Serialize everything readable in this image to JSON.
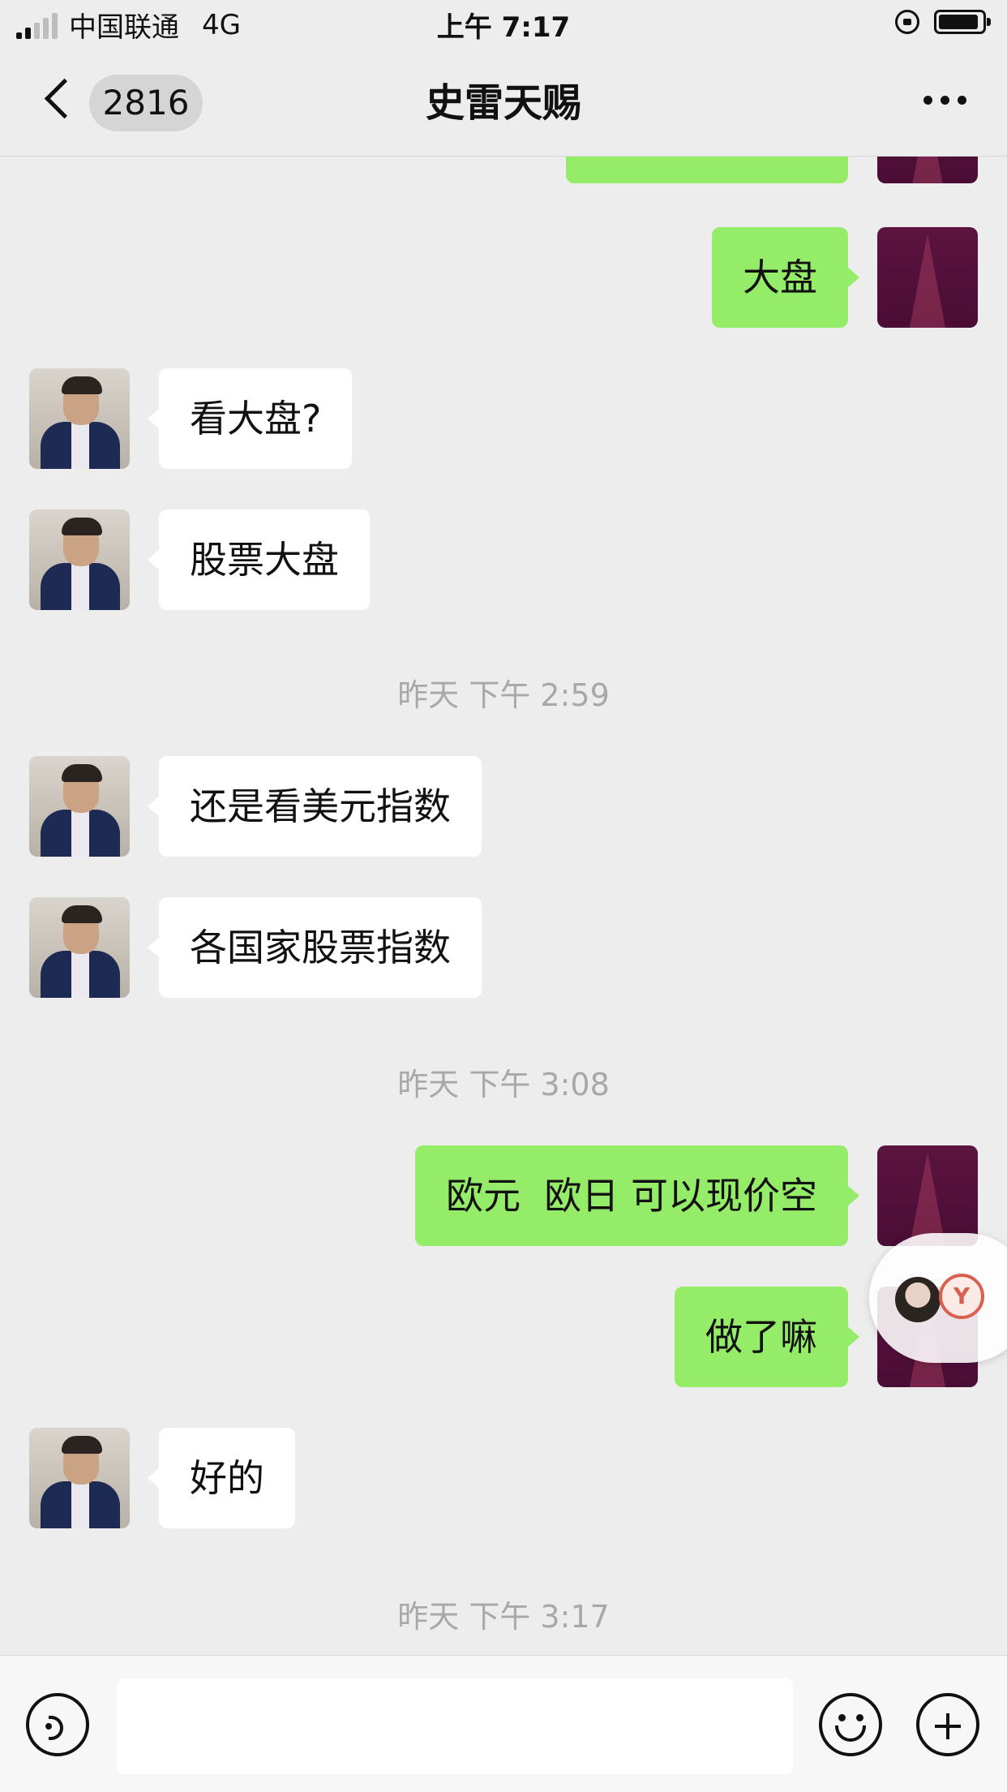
{
  "status_bar": {
    "carrier": "中国联通",
    "network": "4G",
    "time": "上午 7:17"
  },
  "nav": {
    "unread_count": "2816",
    "title": "史雷天赐"
  },
  "messages": [
    {
      "from": "me",
      "text": "大盘"
    },
    {
      "from": "other",
      "text": "看大盘?"
    },
    {
      "from": "other",
      "text": "股票大盘"
    },
    {
      "type": "time",
      "text": "昨天 下午 2:59"
    },
    {
      "from": "other",
      "text": "还是看美元指数"
    },
    {
      "from": "other",
      "text": "各国家股票指数"
    },
    {
      "type": "time",
      "text": "昨天 下午 3:08"
    },
    {
      "from": "me",
      "text": "欧元  欧日 可以现价空"
    },
    {
      "from": "me",
      "text": "做了嘛"
    },
    {
      "from": "other",
      "text": "好的"
    },
    {
      "type": "time",
      "text": "昨天 下午 3:17"
    }
  ],
  "input": {
    "value": "",
    "placeholder": ""
  },
  "icons": {
    "back": "chevron-left-icon",
    "more": "more-dots-icon",
    "voice": "voice-icon",
    "emoji": "emoji-icon",
    "plus": "plus-icon"
  },
  "colors": {
    "my_bubble": "#95ec69",
    "other_bubble": "#ffffff",
    "background": "#ededed"
  }
}
